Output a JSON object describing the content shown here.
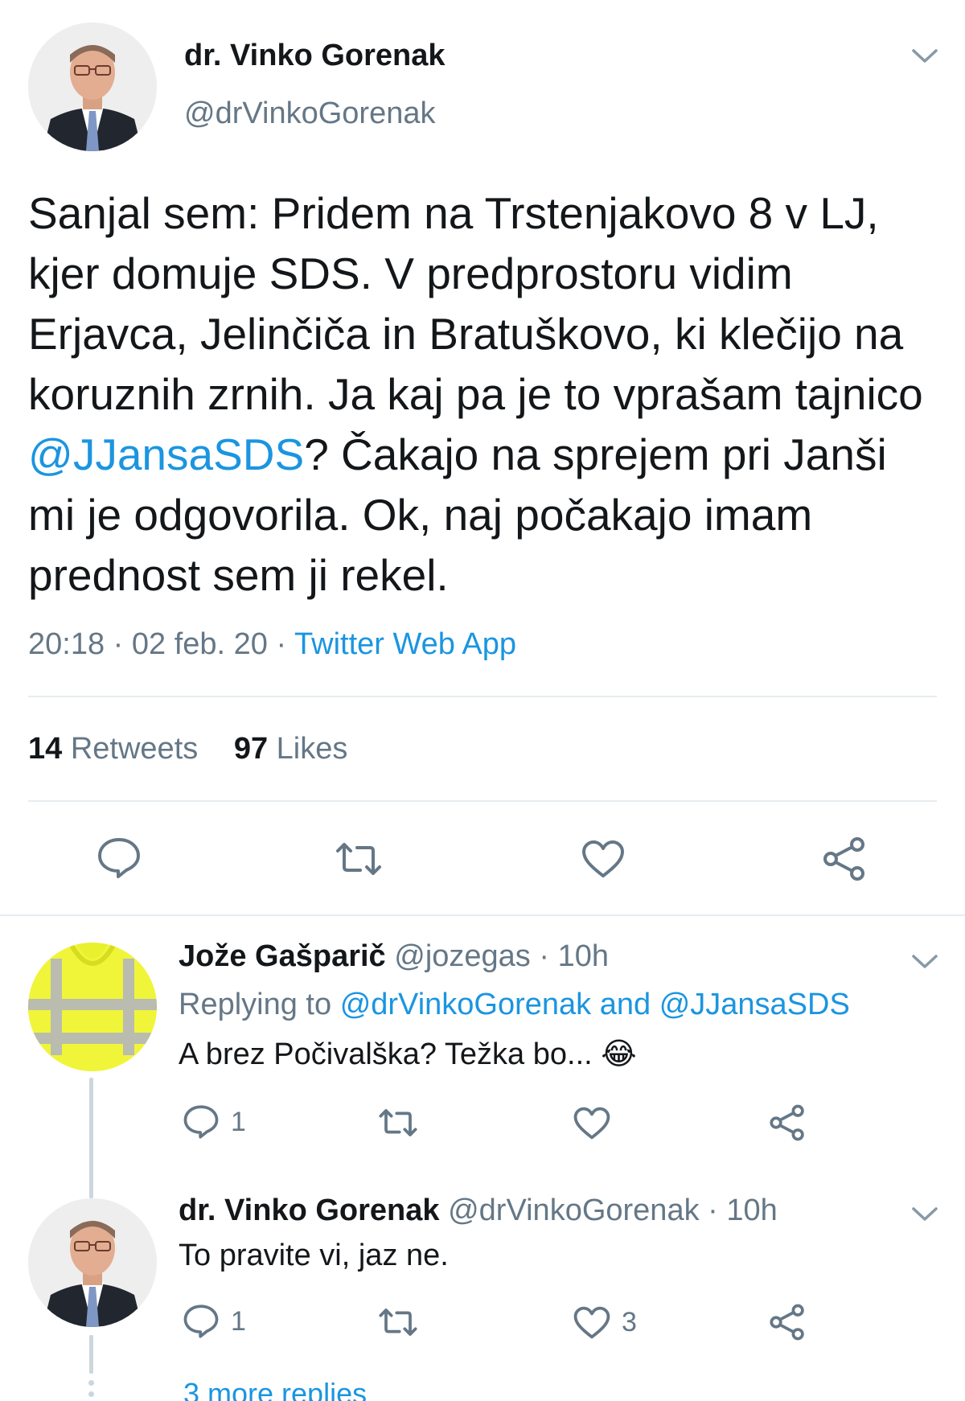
{
  "main_tweet": {
    "author_name": "dr. Vinko Gorenak",
    "author_handle": "@drVinkoGorenak",
    "text_part1": "Sanjal sem: Pridem na Trstenjakovo 8 v LJ, kjer domuje SDS. V predprostoru vidim Erjavca, Jelinčiča in Bratuškovo, ki klečijo na koruznih zrnih. Ja kaj pa je to vprašam tajnico ",
    "mention": "@JJansaSDS",
    "text_part2": "? Čakajo na sprejem pri Janši mi je odgovorila. Ok, naj počakajo imam prednost sem ji rekel.",
    "time": "20:18",
    "date": "02 feb. 20",
    "separator": "·",
    "source": "Twitter Web App",
    "retweets_count": "14",
    "retweets_label": "Retweets",
    "likes_count": "97",
    "likes_label": "Likes"
  },
  "replies": [
    {
      "name": "Jože Gašparič",
      "handle": "@jozegas",
      "separator": "·",
      "age": "10h",
      "replying_prefix": "Replying to",
      "replying_mention1": "@drVinkoGorenak",
      "replying_and": "and",
      "replying_mention2": "@JJansaSDS",
      "text": "A brez Počivalška? Težka bo...",
      "emoji": "😂",
      "reply_count": "1",
      "retweet_count": "",
      "like_count": ""
    },
    {
      "name": "dr. Vinko Gorenak",
      "handle": "@drVinkoGorenak",
      "separator": "·",
      "age": "10h",
      "text": "To pravite vi, jaz ne.",
      "reply_count": "1",
      "retweet_count": "",
      "like_count": "3"
    }
  ],
  "more_replies": "3 more replies",
  "icons": {
    "reply": "reply-icon",
    "retweet": "retweet-icon",
    "like": "heart-icon",
    "share": "share-icon",
    "caret": "chevron-down-icon"
  },
  "colors": {
    "link": "#1b95e0",
    "secondary_text": "#657786",
    "primary_text": "#14171a",
    "divider": "#e6ecf0",
    "vest": "#f0f53a"
  }
}
